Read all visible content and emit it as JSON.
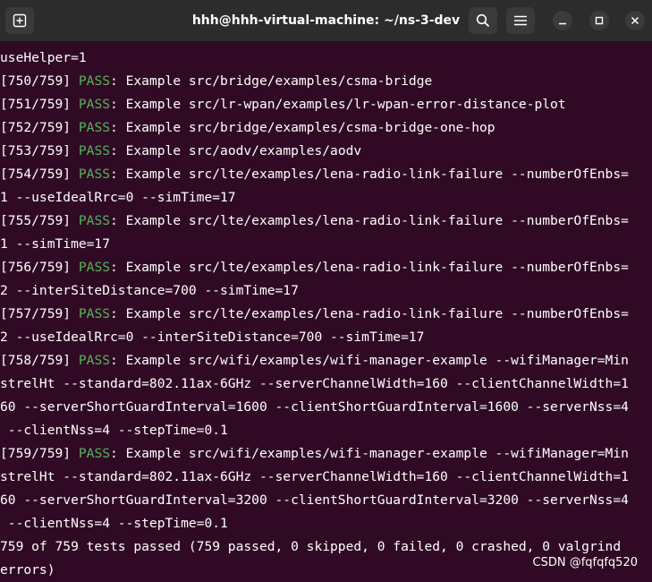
{
  "window": {
    "title": "hhh@hhh-virtual-machine: ~/ns-3-dev"
  },
  "colors": {
    "background": "#300a24",
    "titlebar": "#2c2c2c",
    "pass": "#55b35a"
  },
  "titlebar": {
    "new_tab_icon": "new-tab-icon",
    "search_icon": "search-icon",
    "menu_icon": "hamburger-menu-icon",
    "minimize_icon": "minimize-icon",
    "maximize_icon": "maximize-icon",
    "close_icon": "close-icon"
  },
  "terminal": {
    "lines": [
      {
        "text": "useHelper=1"
      },
      {
        "prefix": "[750/759] ",
        "status": "PASS",
        "rest": ": Example src/bridge/examples/csma-bridge"
      },
      {
        "prefix": "[751/759] ",
        "status": "PASS",
        "rest": ": Example src/lr-wpan/examples/lr-wpan-error-distance-plot"
      },
      {
        "prefix": "[752/759] ",
        "status": "PASS",
        "rest": ": Example src/bridge/examples/csma-bridge-one-hop"
      },
      {
        "prefix": "[753/759] ",
        "status": "PASS",
        "rest": ": Example src/aodv/examples/aodv"
      },
      {
        "prefix": "[754/759] ",
        "status": "PASS",
        "rest": ": Example src/lte/examples/lena-radio-link-failure --numberOfEnbs="
      },
      {
        "text": "1 --useIdealRrc=0 --simTime=17"
      },
      {
        "prefix": "[755/759] ",
        "status": "PASS",
        "rest": ": Example src/lte/examples/lena-radio-link-failure --numberOfEnbs="
      },
      {
        "text": "1 --simTime=17"
      },
      {
        "prefix": "[756/759] ",
        "status": "PASS",
        "rest": ": Example src/lte/examples/lena-radio-link-failure --numberOfEnbs="
      },
      {
        "text": "2 --interSiteDistance=700 --simTime=17"
      },
      {
        "prefix": "[757/759] ",
        "status": "PASS",
        "rest": ": Example src/lte/examples/lena-radio-link-failure --numberOfEnbs="
      },
      {
        "text": "2 --useIdealRrc=0 --interSiteDistance=700 --simTime=17"
      },
      {
        "prefix": "[758/759] ",
        "status": "PASS",
        "rest": ": Example src/wifi/examples/wifi-manager-example --wifiManager=Min"
      },
      {
        "text": "strelHt --standard=802.11ax-6GHz --serverChannelWidth=160 --clientChannelWidth=1"
      },
      {
        "text": "60 --serverShortGuardInterval=1600 --clientShortGuardInterval=1600 --serverNss=4"
      },
      {
        "text": " --clientNss=4 --stepTime=0.1"
      },
      {
        "prefix": "[759/759] ",
        "status": "PASS",
        "rest": ": Example src/wifi/examples/wifi-manager-example --wifiManager=Min"
      },
      {
        "text": "strelHt --standard=802.11ax-6GHz --serverChannelWidth=160 --clientChannelWidth=1"
      },
      {
        "text": "60 --serverShortGuardInterval=3200 --clientShortGuardInterval=3200 --serverNss=4"
      },
      {
        "text": " --clientNss=4 --stepTime=0.1"
      },
      {
        "text": "759 of 759 tests passed (759 passed, 0 skipped, 0 failed, 0 crashed, 0 valgrind"
      },
      {
        "text": "errors)"
      }
    ]
  },
  "watermark": "CSDN @fqfqfq520"
}
